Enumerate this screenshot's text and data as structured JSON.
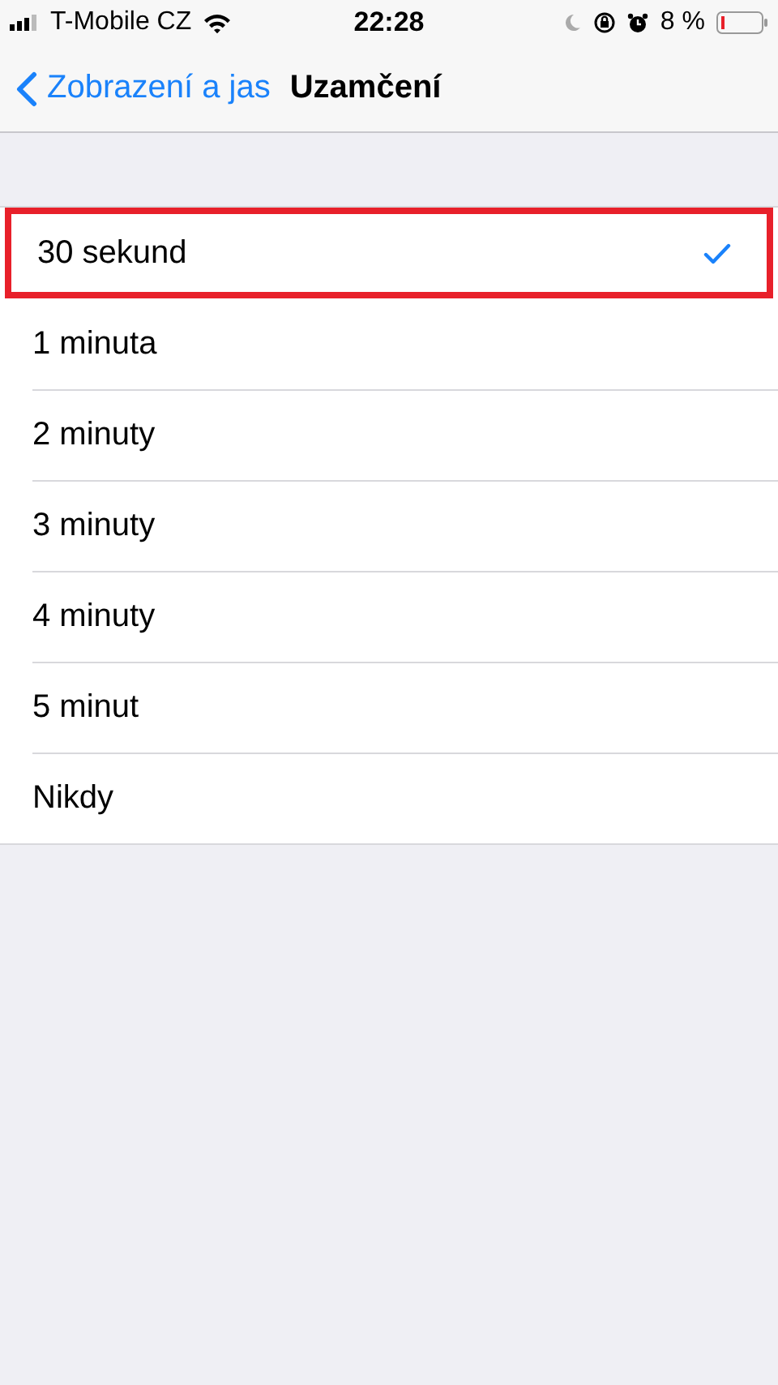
{
  "status_bar": {
    "carrier": "T-Mobile CZ",
    "time": "22:28",
    "battery": "8 %"
  },
  "nav": {
    "back": "Zobrazení a jas",
    "title": "Uzamčení"
  },
  "options": [
    {
      "label": "30 sekund",
      "selected": true,
      "highlighted": true
    },
    {
      "label": "1 minuta",
      "selected": false,
      "highlighted": false
    },
    {
      "label": "2 minuty",
      "selected": false,
      "highlighted": false
    },
    {
      "label": "3 minuty",
      "selected": false,
      "highlighted": false
    },
    {
      "label": "4 minuty",
      "selected": false,
      "highlighted": false
    },
    {
      "label": "5 minut",
      "selected": false,
      "highlighted": false
    },
    {
      "label": "Nikdy",
      "selected": false,
      "highlighted": false
    }
  ]
}
